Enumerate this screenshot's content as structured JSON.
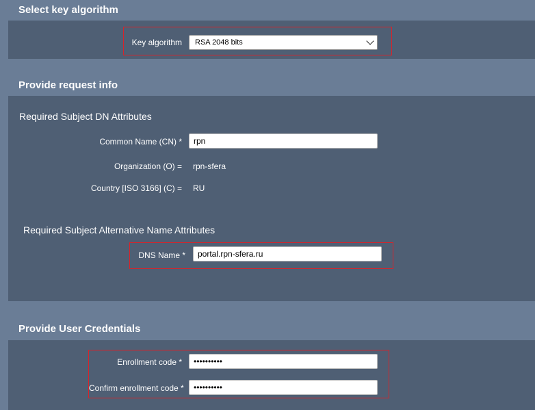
{
  "key_section": {
    "title": "Select key algorithm",
    "label": "Key algorithm",
    "selected": "RSA 2048 bits"
  },
  "request_section": {
    "title": "Provide request info",
    "dn_heading": "Required Subject DN Attributes",
    "cn_label": "Common Name (CN) *",
    "cn_value": "rpn",
    "org_label": "Organization (O) =",
    "org_value": "rpn-sfera",
    "country_label": "Country [ISO 3166] (C) =",
    "country_value": "RU",
    "san_heading": "Required Subject Alternative Name Attributes",
    "dns_label": "DNS Name *",
    "dns_value": "portal.rpn-sfera.ru"
  },
  "credentials_section": {
    "title": "Provide User Credentials",
    "enroll_label": "Enrollment code *",
    "enroll_value": "••••••••••",
    "confirm_label": "Confirm enrollment code *",
    "confirm_value": "••••••••••"
  },
  "colors": {
    "outer_bg": "#6a7d96",
    "panel_bg": "#4f5f74",
    "highlight": "#d8232a"
  }
}
